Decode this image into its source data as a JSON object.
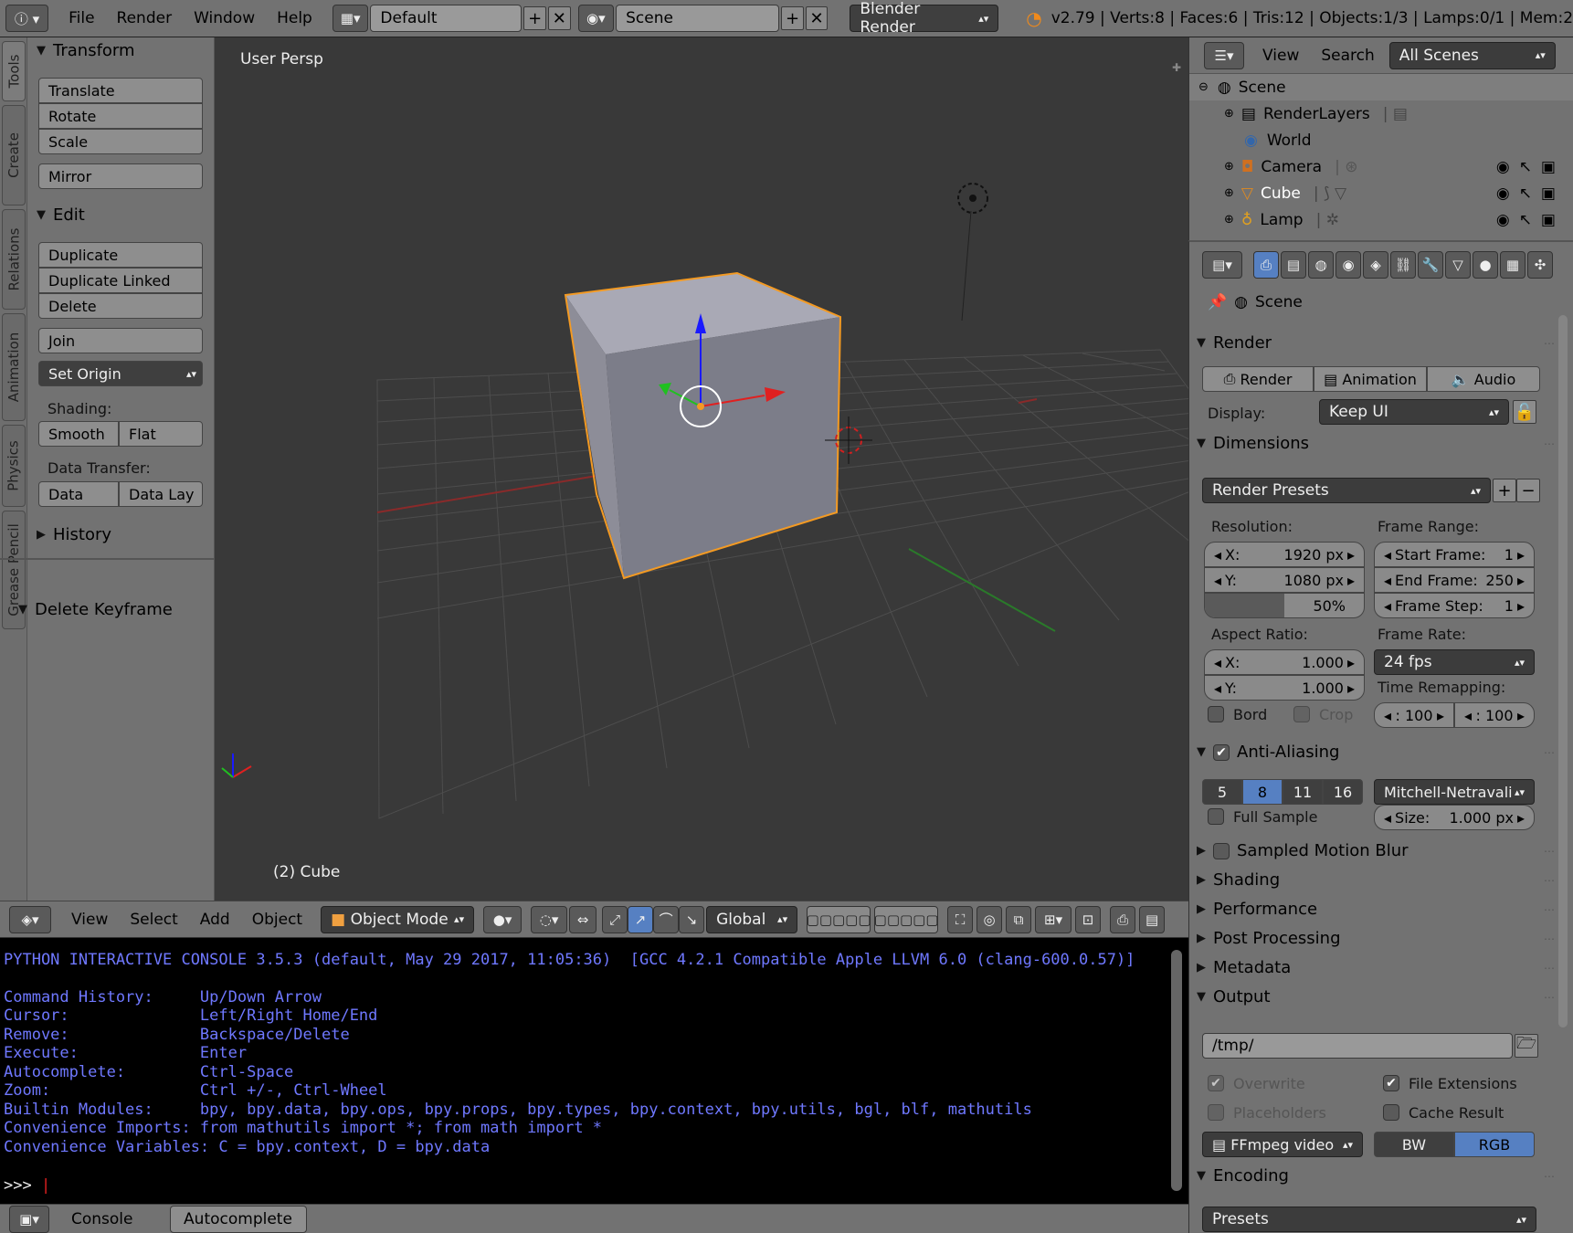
{
  "topbar": {
    "menus": [
      "File",
      "Render",
      "Window",
      "Help"
    ],
    "layout": "Default",
    "scene": "Scene",
    "engine": "Blender Render",
    "stats": "v2.79 | Verts:8 | Faces:6 | Tris:12 | Objects:1/3 | Lamps:0/1 | Mem:2"
  },
  "side_tabs": [
    "Tools",
    "Create",
    "Relations",
    "Animation",
    "Physics",
    "Grease Pencil"
  ],
  "tool_panel": {
    "transform_title": "Transform",
    "translate": "Translate",
    "rotate": "Rotate",
    "scale": "Scale",
    "mirror": "Mirror",
    "edit_title": "Edit",
    "duplicate": "Duplicate",
    "duplicate_linked": "Duplicate Linked",
    "delete": "Delete",
    "join": "Join",
    "set_origin": "Set Origin",
    "shading_label": "Shading:",
    "smooth": "Smooth",
    "flat": "Flat",
    "data_transfer_label": "Data Transfer:",
    "data": "Data",
    "data_lay": "Data Lay",
    "history_title": "History",
    "operator_title": "Delete Keyframe"
  },
  "viewport": {
    "view_name": "User Persp",
    "object_label": "(2) Cube"
  },
  "view_header": {
    "menus": [
      "View",
      "Select",
      "Add",
      "Object"
    ],
    "mode": "Object Mode",
    "orientation": "Global"
  },
  "console": {
    "lines": [
      "PYTHON INTERACTIVE CONSOLE 3.5.3 (default, May 29 2017, 11:05:36)  [GCC 4.2.1 Compatible Apple LLVM 6.0 (clang-600.0.57)]",
      "",
      "Command History:     Up/Down Arrow",
      "Cursor:              Left/Right Home/End",
      "Remove:              Backspace/Delete",
      "Execute:             Enter",
      "Autocomplete:        Ctrl-Space",
      "Zoom:                Ctrl +/-, Ctrl-Wheel",
      "Builtin Modules:     bpy, bpy.data, bpy.ops, bpy.props, bpy.types, bpy.context, bpy.utils, bgl, blf, mathutils",
      "Convenience Imports: from mathutils import *; from math import *",
      "Convenience Variables: C = bpy.context, D = bpy.data"
    ],
    "prompt": ">>> ",
    "footer_console": "Console",
    "footer_autocomplete": "Autocomplete"
  },
  "outliner": {
    "view": "View",
    "search": "Search",
    "filter": "All Scenes",
    "items": [
      "Scene",
      "RenderLayers",
      "World",
      "Camera",
      "Cube",
      "Lamp"
    ]
  },
  "properties": {
    "context_label": "Scene",
    "render_section": "Render",
    "render_btn": "Render",
    "animation_btn": "Animation",
    "audio_btn": "Audio",
    "display_label": "Display:",
    "display_value": "Keep UI",
    "dimensions_section": "Dimensions",
    "render_presets": "Render Presets",
    "resolution_label": "Resolution:",
    "res_x_label": "X:",
    "res_x": "1920 px",
    "res_y_label": "Y:",
    "res_y": "1080 px",
    "res_pct": "50%",
    "res_pct_fraction": 0.5,
    "frame_range_label": "Frame Range:",
    "start_label": "Start Frame:",
    "start_value": "1",
    "end_label": "End Frame:",
    "end_value": "250",
    "step_label": "Frame Step:",
    "step_value": "1",
    "aspect_label": "Aspect Ratio:",
    "aspect_x_label": "X:",
    "aspect_x": "1.000",
    "aspect_y_label": "Y:",
    "aspect_y": "1.000",
    "frame_rate_label": "Frame Rate:",
    "frame_rate": "24 fps",
    "time_remap_label": "Time Remapping:",
    "remap_old": ": 100",
    "remap_new": ": 100",
    "bord": "Bord",
    "crop": "Crop",
    "aa_section": "Anti-Aliasing",
    "aa_samples": [
      "5",
      "8",
      "11",
      "16"
    ],
    "aa_filter": "Mitchell-Netravali",
    "full_sample": "Full Sample",
    "size_label": "Size:",
    "size_value": "1.000 px",
    "motion_blur": "Sampled Motion Blur",
    "shading": "Shading",
    "performance": "Performance",
    "post_processing": "Post Processing",
    "metadata": "Metadata",
    "output": "Output",
    "output_path": "/tmp/",
    "overwrite": "Overwrite",
    "file_extensions": "File Extensions",
    "placeholders": "Placeholders",
    "cache_result": "Cache Result",
    "format": "FFmpeg video",
    "bw": "BW",
    "rgb": "RGB",
    "encoding": "Encoding",
    "presets": "Presets"
  },
  "colors": {
    "selection_orange": "#f39a23",
    "active_blue": "#5680c2",
    "console_text": "#6f78ff"
  }
}
